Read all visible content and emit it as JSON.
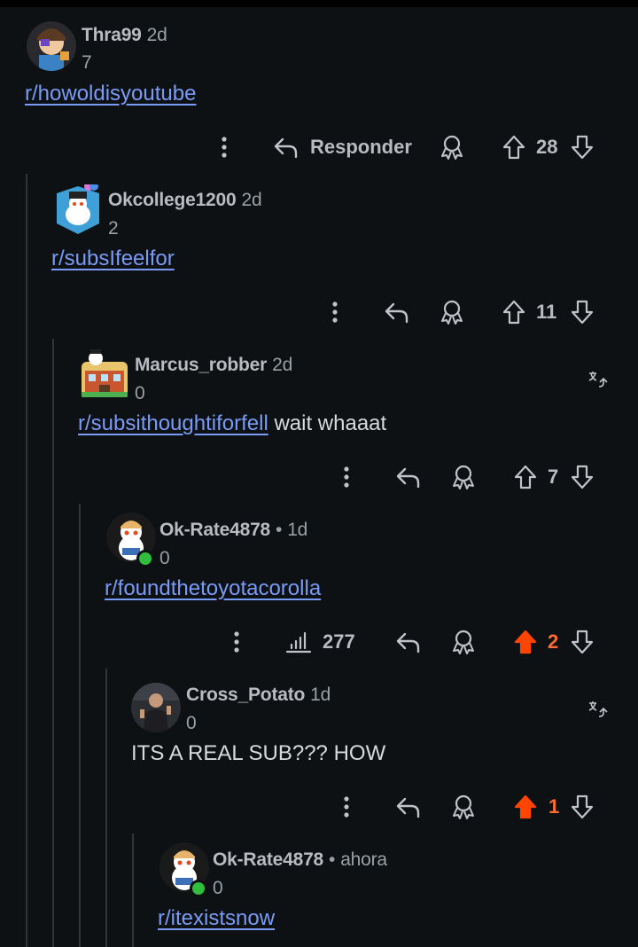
{
  "comments": [
    {
      "author": "Thra99",
      "time": "2d",
      "score": "7",
      "link": "r/howoldisyoutube",
      "text": "",
      "reply_label": "Responder",
      "votes": "28",
      "upvoted": false
    },
    {
      "author": "Okcollege1200",
      "time": "2d",
      "score": "2",
      "link": "r/subsIfeelfor",
      "text": "",
      "reply_label": "",
      "votes": "11",
      "upvoted": false
    },
    {
      "author": "Marcus_robber",
      "time": "2d",
      "score": "0",
      "link": "r/subsithoughtiforfell",
      "text": "wait whaaat",
      "reply_label": "",
      "votes": "7",
      "upvoted": false
    },
    {
      "author": "Ok-Rate4878",
      "time": "1d",
      "score": "0",
      "link": "r/foundthetoyotacorolla",
      "text": "",
      "reply_label": "",
      "votes": "2",
      "views": "277",
      "upvoted": true
    },
    {
      "author": "Cross_Potato",
      "time": "1d",
      "score": "0",
      "link": "",
      "text": "ITS A REAL SUB??? HOW",
      "reply_label": "",
      "votes": "1",
      "upvoted": true
    },
    {
      "author": "Ok-Rate4878",
      "time": "ahora",
      "score": "0",
      "link": "r/itexistsnow",
      "text": "",
      "reply_label": "",
      "votes": "",
      "upvoted": false
    }
  ],
  "separator": "•",
  "colors": {
    "background": "#0e1113",
    "link": "#7a9bf5",
    "upvote_active": "#ff4500",
    "online": "#2fbf3c"
  },
  "icons": {
    "more": "more-vertical-icon",
    "reply": "reply-arrow-icon",
    "award": "award-icon",
    "upvote": "upvote-arrow-icon",
    "downvote": "downvote-arrow-icon",
    "views": "bar-chart-icon",
    "translate": "translate-icon"
  }
}
